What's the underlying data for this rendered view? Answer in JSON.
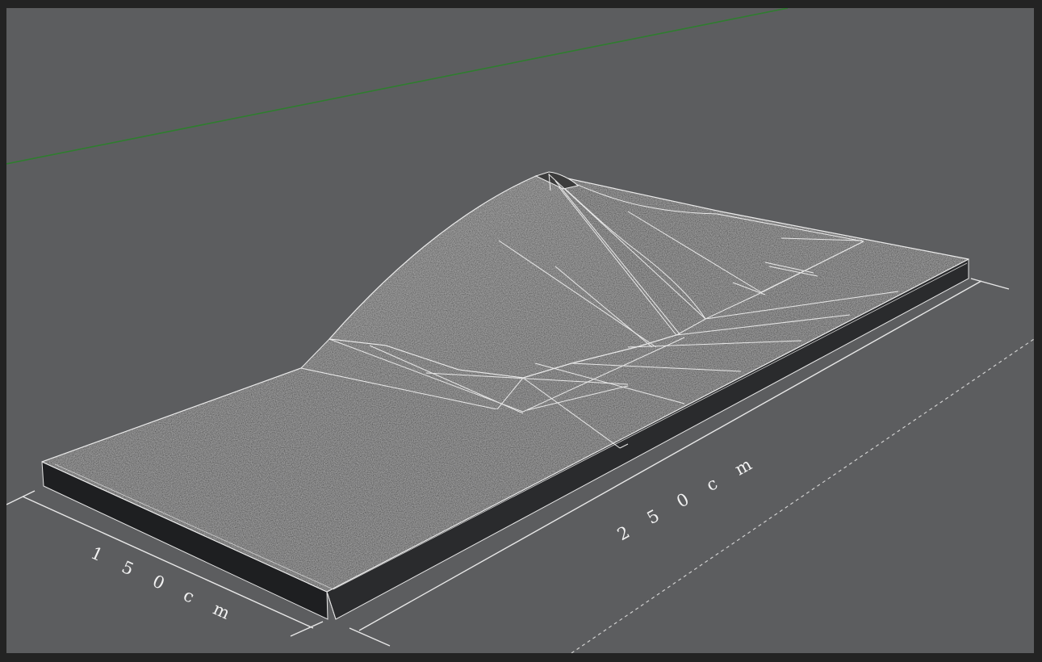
{
  "viewport": {
    "background": "#5c5d5f",
    "frame": "#232323"
  },
  "dimensions": {
    "width_label": "1 5 0   c m",
    "length_label": "2 5 0   c m"
  },
  "colors": {
    "surface": "#2e2e2e",
    "edges": "#e6e6e6",
    "axis_green": "#2f7d2f",
    "dimension_line": "#e8e8e8"
  }
}
